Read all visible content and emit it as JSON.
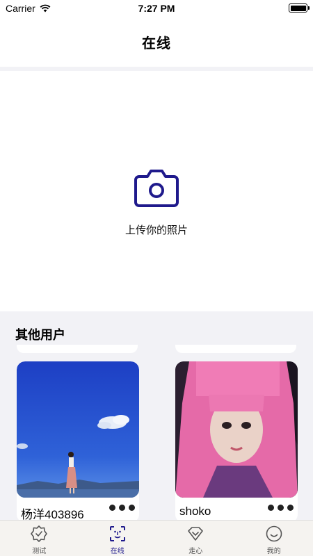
{
  "status_bar": {
    "carrier": "Carrier",
    "time": "7:27 PM"
  },
  "nav": {
    "title": "在线"
  },
  "upload": {
    "label": "上传你的照片",
    "icon": "camera-icon"
  },
  "section": {
    "title": "其他用户"
  },
  "users": [
    {
      "name": "杨洋403896",
      "photo": "lakeside-portrait"
    },
    {
      "name": "shoko",
      "photo": "pink-hair-portrait"
    }
  ],
  "tabs": [
    {
      "label": "测试",
      "icon": "badge-check-icon",
      "active": false
    },
    {
      "label": "在线",
      "icon": "face-scan-icon",
      "active": true
    },
    {
      "label": "走心",
      "icon": "heart-diamond-icon",
      "active": false
    },
    {
      "label": "我的",
      "icon": "smile-icon",
      "active": false
    }
  ],
  "colors": {
    "accent": "#1f1a8c",
    "background": "#f2f2f6"
  }
}
